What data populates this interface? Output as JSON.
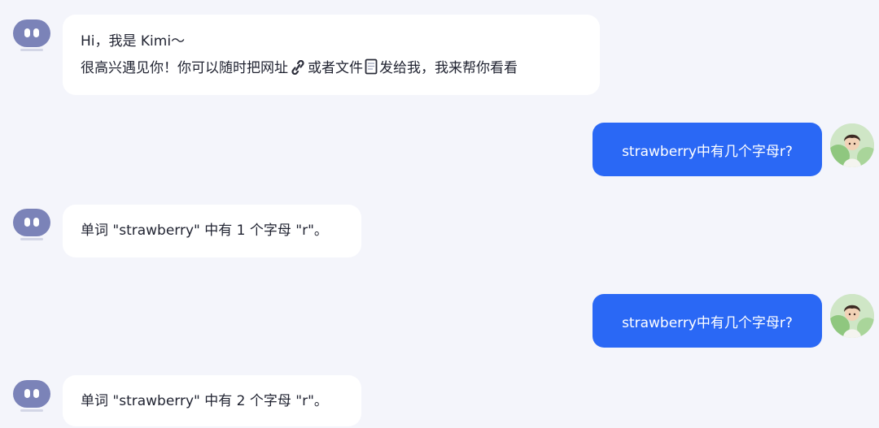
{
  "messages": [
    {
      "role": "assistant",
      "line1": "Hi，我是 Kimi～",
      "line2_part1": "很高兴遇见你！你可以随时把网址",
      "line2_part2": "或者文件",
      "line2_part3": "发给我，我来帮你看看",
      "inline_icons": [
        "link-icon",
        "file-icon"
      ]
    },
    {
      "role": "user",
      "text": "strawberry中有几个字母r?"
    },
    {
      "role": "assistant",
      "text": "单词 \"strawberry\" 中有 1 个字母 \"r\"。"
    },
    {
      "role": "user",
      "text": "strawberry中有几个字母r?"
    },
    {
      "role": "assistant",
      "text": "单词 \"strawberry\" 中有 2 个字母 \"r\"。"
    }
  ],
  "colors": {
    "background": "#f4f5fb",
    "user_bubble": "#2a68f5",
    "assistant_bubble": "#ffffff",
    "bot_avatar": "#7b83b8"
  },
  "icons": {
    "assistant_avatar": "kimi-bot-avatar-icon",
    "user_avatar": "user-avatar-illustration"
  }
}
